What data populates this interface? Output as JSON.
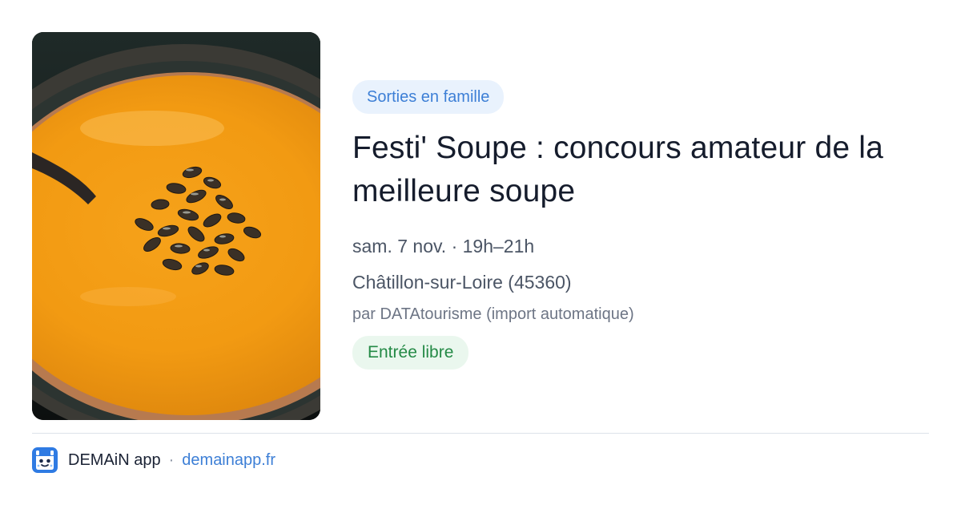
{
  "event": {
    "image_alt": "Bol de soupe de potiron avec graines de courge",
    "category": "Sorties en famille",
    "title": "Festi' Soupe : concours amateur de la meilleure soupe",
    "date_time": "sam. 7 nov. · 19h–21h",
    "location": "Châtillon-sur-Loire (45360)",
    "source": "par DATAtourisme (import automatique)",
    "price": "Entrée libre"
  },
  "footer": {
    "logo_icon": "demain-logo-icon",
    "app_name": "DEMAiN app",
    "separator": "·",
    "domain": "demainapp.fr"
  },
  "colors": {
    "accent_blue": "#3d7fd6",
    "category_bg": "#e9f2fd",
    "price_green": "#248a46",
    "price_bg": "#eaf7ee",
    "title_text": "#151c2c",
    "secondary_text": "#4b5565"
  }
}
